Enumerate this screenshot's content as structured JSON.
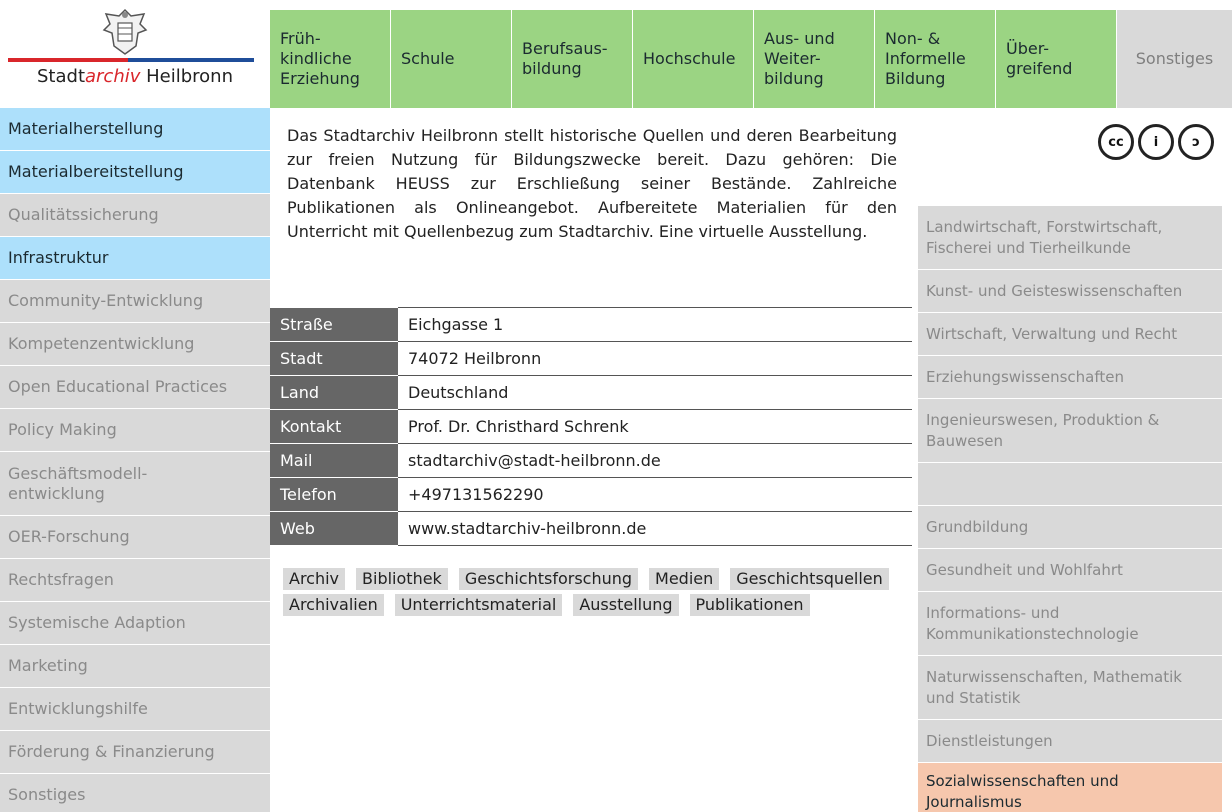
{
  "logo": {
    "prefix": "Stadt",
    "emph": "archiv",
    "suffix": " Heilbronn"
  },
  "topnav": [
    {
      "label": "Früh-\nkindliche\nErziehung",
      "dim": false
    },
    {
      "label": "Schule",
      "dim": false
    },
    {
      "label": "Berufsaus-\nbildung",
      "dim": false
    },
    {
      "label": "Hochschule",
      "dim": false
    },
    {
      "label": "Aus- und\nWeiter-\nbildung",
      "dim": false
    },
    {
      "label": "Non- &\nInformelle\nBildung",
      "dim": false
    },
    {
      "label": "Über-\ngreifend",
      "dim": false
    },
    {
      "label": "Sonstiges",
      "dim": true
    }
  ],
  "leftnav": [
    {
      "label": "Materialherstellung",
      "active": true
    },
    {
      "label": "Materialbereitstellung",
      "active": true
    },
    {
      "label": "Qualitätssicherung",
      "active": false
    },
    {
      "label": "Infrastruktur",
      "active": true
    },
    {
      "label": "Community-Entwicklung",
      "active": false
    },
    {
      "label": "Kompetenzentwicklung",
      "active": false
    },
    {
      "label": "Open Educational Practices",
      "active": false
    },
    {
      "label": "Policy Making",
      "active": false
    },
    {
      "label": "Geschäftsmodell-\nentwicklung",
      "active": false
    },
    {
      "label": "OER-Forschung",
      "active": false
    },
    {
      "label": "Rechtsfragen",
      "active": false
    },
    {
      "label": "Systemische Adaption",
      "active": false
    },
    {
      "label": "Marketing",
      "active": false
    },
    {
      "label": "Entwicklungshilfe",
      "active": false
    },
    {
      "label": "Förderung & Finanzierung",
      "active": false
    },
    {
      "label": "Sonstiges",
      "active": false
    }
  ],
  "intro": "Das Stadtarchiv Heilbronn stellt historische Quellen und deren Bearbeitung zur freien Nutzung für Bildungszwecke bereit. Dazu gehören: Die Datenbank HEUSS zur Erschließung seiner Bestände. Zahlreiche Publikationen als Onlineangebot. Aufbereitete Materialien für den Unterricht mit Quellenbezug zum Stadtarchiv. Eine virtuelle Ausstellung.",
  "info": [
    {
      "key": "Straße",
      "value": "Eichgasse 1"
    },
    {
      "key": "Stadt",
      "value": "74072 Heilbronn"
    },
    {
      "key": "Land",
      "value": "Deutschland"
    },
    {
      "key": "Kontakt",
      "value": "Prof. Dr. Christhard Schrenk"
    },
    {
      "key": "Mail",
      "value": "stadtarchiv@stadt-heilbronn.de"
    },
    {
      "key": "Telefon",
      "value": "+497131562290"
    },
    {
      "key": "Web",
      "value": "www.stadtarchiv-heilbronn.de"
    }
  ],
  "tags": [
    "Archiv",
    "Bibliothek",
    "Geschichtsforschung",
    "Medien",
    "Geschichtsquellen",
    "Archivalien",
    "Unterrichtsmaterial",
    "Ausstellung",
    "Publikationen"
  ],
  "license": {
    "icons": [
      "cc-icon",
      "by-icon",
      "sa-icon"
    ],
    "symbols": [
      "cc",
      "i",
      "ↄ"
    ]
  },
  "rightnav": [
    {
      "label": "Landwirtschaft, Forstwirtschaft, Fischerei und Tierheilkunde",
      "hl": false
    },
    {
      "label": "Kunst- und Geisteswissenschaften",
      "hl": false
    },
    {
      "label": "Wirtschaft, Verwaltung und Recht",
      "hl": false
    },
    {
      "label": "Erziehungswissenschaften",
      "hl": false
    },
    {
      "label": "Ingenieurswesen, Produktion & Bauwesen",
      "hl": false
    },
    {
      "label": "",
      "hl": false
    },
    {
      "label": "Grundbildung",
      "hl": false
    },
    {
      "label": "Gesundheit und Wohlfahrt",
      "hl": false
    },
    {
      "label": "Informations- und Kommunikationstechnologie",
      "hl": false
    },
    {
      "label": "Naturwissenschaften, Mathematik und Statistik",
      "hl": false
    },
    {
      "label": "Dienstleistungen",
      "hl": false
    },
    {
      "label": "Sozialwissenschaften und Journalismus",
      "hl": true
    }
  ],
  "colors": {
    "nav_green": "#9bd483",
    "active_blue": "#ade0fb",
    "highlight_orange": "#f6c7ad",
    "inactive_gray": "#d9d9d9",
    "label_gray": "#666666",
    "brand_red": "#d9262b",
    "brand_blue": "#1f4d99"
  }
}
